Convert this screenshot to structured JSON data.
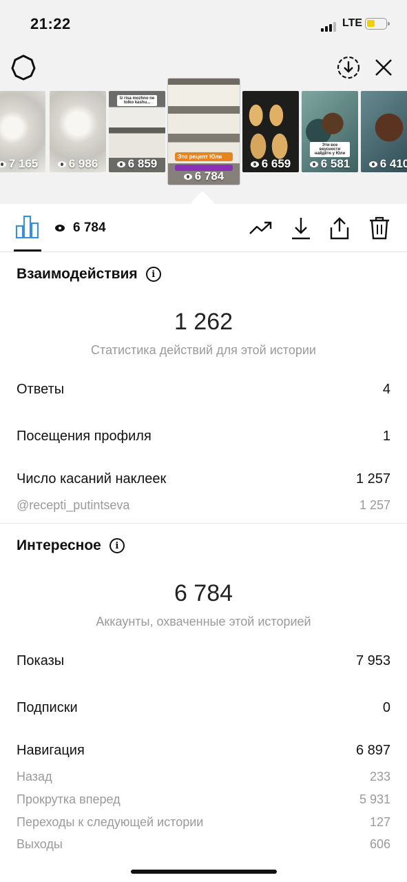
{
  "status_bar": {
    "time": "21:22",
    "network": "LTE"
  },
  "stories": [
    {
      "views": "7 165",
      "selected": false,
      "bg": "#e8e6df"
    },
    {
      "views": "6 986",
      "selected": false,
      "bg": "#e4e2dc"
    },
    {
      "views": "6 859",
      "selected": false,
      "bg": "#8a8a88",
      "caption": "Iz risa mozhno ne tolko kashu..."
    },
    {
      "views": "6 784",
      "selected": true,
      "bg": "#7b776f",
      "tag": "Это рецепт Юли"
    },
    {
      "views": "6 659",
      "selected": false,
      "bg": "#222220"
    },
    {
      "views": "6 581",
      "selected": false,
      "bg": "#6b8e8a",
      "caption": "Эти все вкусности найдёте у Юли"
    },
    {
      "views": "6 410",
      "selected": false,
      "bg": "#4a6a70"
    }
  ],
  "toolbar": {
    "views": "6 784"
  },
  "interactions": {
    "title": "Взаимодействия",
    "total": "1 262",
    "subtitle": "Статистика действий для этой истории",
    "rows": [
      {
        "label": "Ответы",
        "value": "4"
      },
      {
        "label": "Посещения профиля",
        "value": "1"
      },
      {
        "label": "Число касаний наклеек",
        "value": "1 257"
      }
    ],
    "sticker": {
      "label": "@recepti_putintseva",
      "value": "1 257"
    }
  },
  "discovery": {
    "title": "Интересное",
    "total": "6 784",
    "subtitle": "Аккаунты, охваченные этой историей",
    "rows": [
      {
        "label": "Показы",
        "value": "7 953"
      },
      {
        "label": "Подписки",
        "value": "0"
      },
      {
        "label": "Навигация",
        "value": "6 897"
      }
    ],
    "navigation": [
      {
        "label": "Назад",
        "value": "233"
      },
      {
        "label": "Прокрутка вперед",
        "value": "5 931"
      },
      {
        "label": "Переходы к следующей истории",
        "value": "127"
      },
      {
        "label": "Выходы",
        "value": "606"
      }
    ]
  }
}
